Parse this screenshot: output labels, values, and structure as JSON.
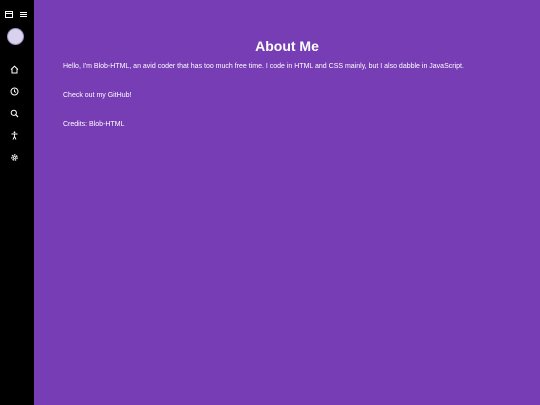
{
  "sidebar": {
    "top_icons": [
      "window-icon",
      "menu-icon"
    ],
    "nav_items": [
      {
        "name": "home-icon"
      },
      {
        "name": "clock-icon"
      },
      {
        "name": "search-icon"
      },
      {
        "name": "accessibility-icon"
      },
      {
        "name": "settings-icon"
      }
    ]
  },
  "main": {
    "title": "About Me",
    "intro": "Hello, I'm Blob-HTML, an avid coder that has too much free time. I code in HTML and CSS mainly, but I also dabble in JavaScript.",
    "github": "Check out my GitHub!",
    "credits": "Credits: Blob-HTML"
  },
  "colors": {
    "background": "#773db4",
    "sidebar": "#000000",
    "text": "#ffffff"
  }
}
